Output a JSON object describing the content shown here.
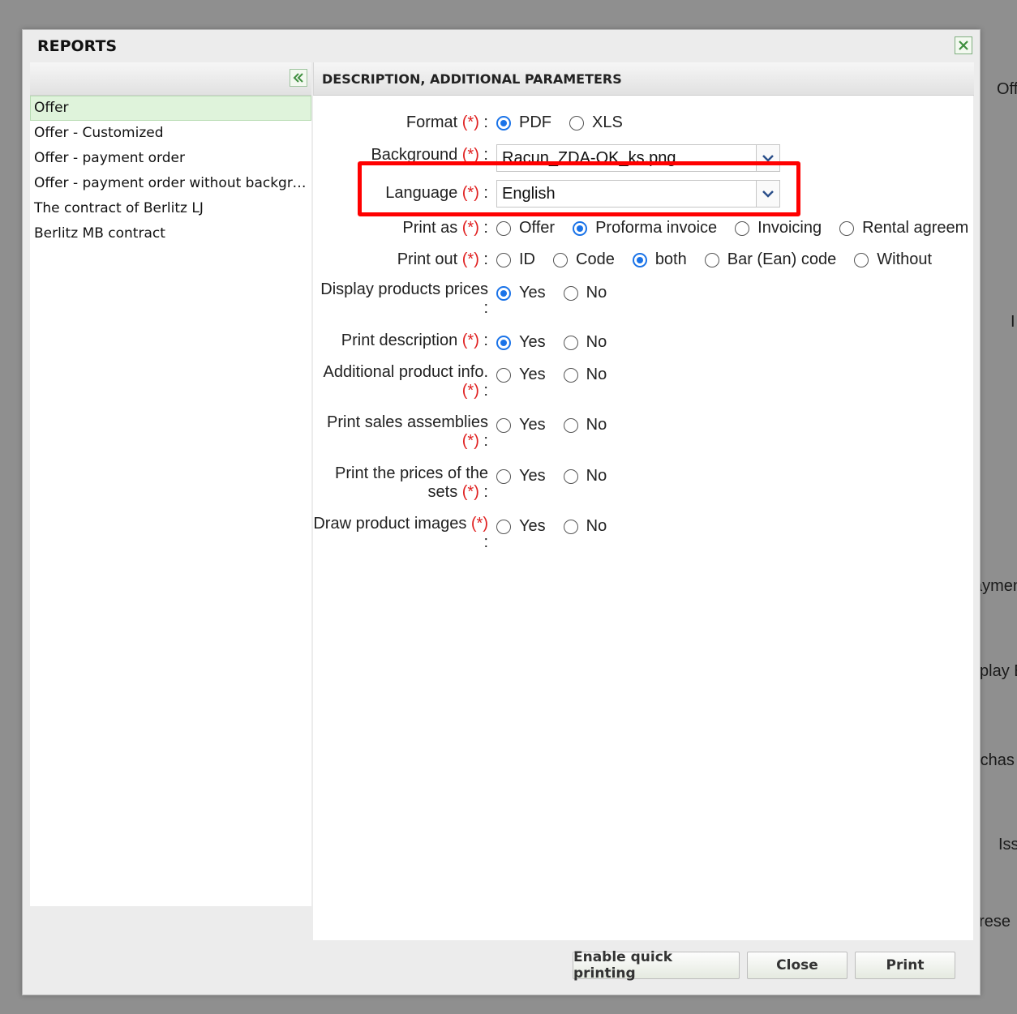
{
  "background_fragments": [
    "Off",
    "I",
    "aymen",
    "splay E",
    "rchas",
    "Iss",
    "prese"
  ],
  "dialog": {
    "title": "REPORTS",
    "close_icon": "close-icon",
    "collapse_icon": "double-chevron-left-icon"
  },
  "report_list": {
    "items": [
      "Offer",
      "Offer - Customized",
      "Offer - payment order",
      "Offer - payment order without backgrou...",
      "The contract of Berlitz LJ",
      "Berlitz MB contract"
    ],
    "selected_index": 0
  },
  "params": {
    "header": "DESCRIPTION, ADDITIONAL PARAMETERS",
    "required_mark": "(*)",
    "format": {
      "label": "Format",
      "options": [
        "PDF",
        "XLS"
      ],
      "selected": "PDF"
    },
    "background": {
      "label": "Background",
      "value": "Racun_ZDA-OK_ks.png"
    },
    "language": {
      "label": "Language",
      "value": "English"
    },
    "print_as": {
      "label": "Print as",
      "options": [
        "Offer",
        "Proforma invoice",
        "Invoicing",
        "Rental agreem"
      ],
      "selected": "Proforma invoice"
    },
    "print_out": {
      "label": "Print out",
      "options": [
        "ID",
        "Code",
        "both",
        "Bar (Ean) code",
        "Without"
      ],
      "selected": "both"
    },
    "display_prices": {
      "label": "Display products prices",
      "options": [
        "Yes",
        "No"
      ],
      "selected": "Yes"
    },
    "print_description": {
      "label": "Print description",
      "options": [
        "Yes",
        "No"
      ],
      "selected": "Yes"
    },
    "additional_info": {
      "label": "Additional product info.",
      "options": [
        "Yes",
        "No"
      ],
      "selected": ""
    },
    "sales_assemblies": {
      "label": "Print sales assemblies",
      "options": [
        "Yes",
        "No"
      ],
      "selected": ""
    },
    "set_prices": {
      "label": "Print the prices of the sets",
      "options": [
        "Yes",
        "No"
      ],
      "selected": ""
    },
    "product_images": {
      "label": "Draw product images",
      "options": [
        "Yes",
        "No"
      ],
      "selected": ""
    }
  },
  "footer": {
    "quick_print_label": "Enable quick printing",
    "close_label": "Close",
    "print_label": "Print"
  },
  "colors": {
    "required": "#e02020",
    "radio_selected": "#1a73e8",
    "highlight": "#ff0000",
    "selected_row": "#dff3db"
  }
}
